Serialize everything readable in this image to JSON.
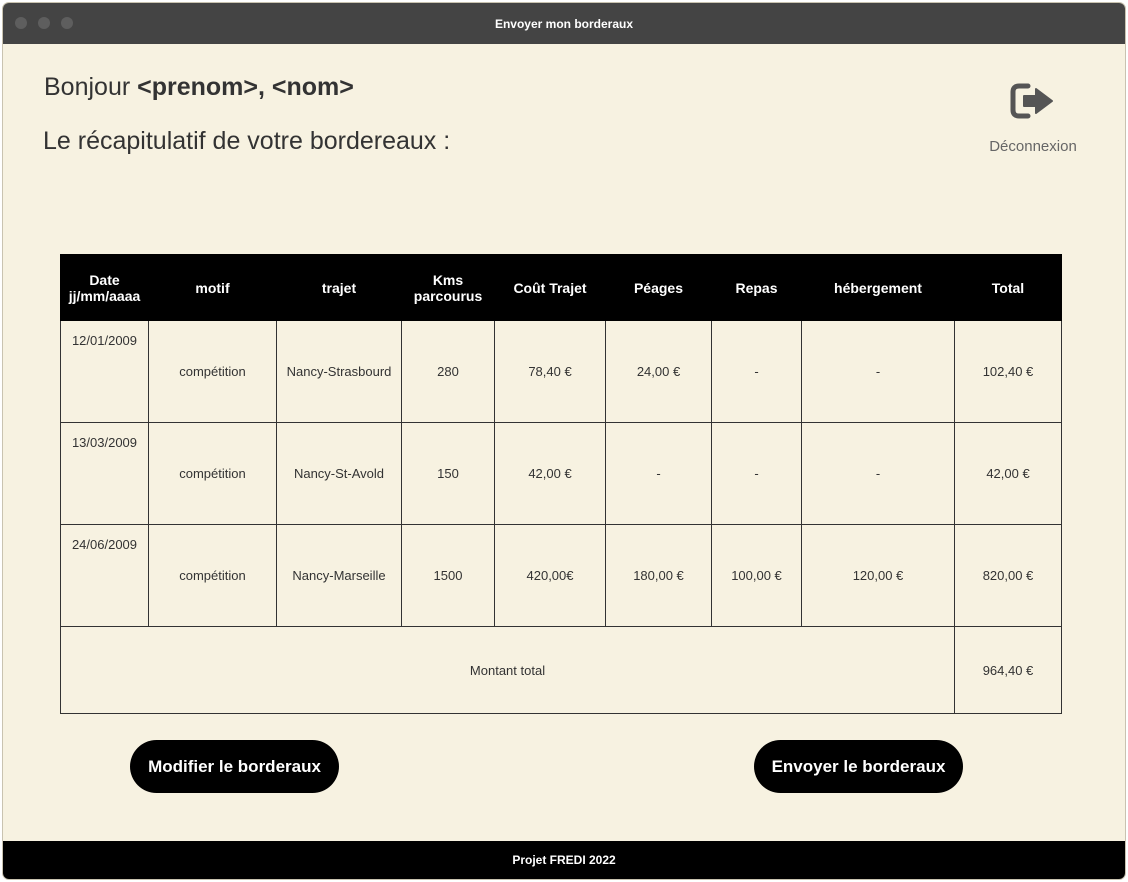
{
  "window": {
    "title": "Envoyer mon borderaux"
  },
  "header": {
    "greeting_prefix": "Bonjour",
    "greeting_name": "<prenom>, <nom>",
    "subtitle": "Le récapitulatif de votre bordereaux :",
    "logout": {
      "icon": "sign-out-icon",
      "label": "Déconnexion"
    }
  },
  "table": {
    "columns": {
      "date_l1": "Date",
      "date_l2": "jj/mm/aaaa",
      "motif": "motif",
      "trajet": "trajet",
      "kms_l1": "Kms",
      "kms_l2": "parcourus",
      "cout": "Coût Trajet",
      "peages": "Péages",
      "repas": "Repas",
      "hebergement": "hébergement",
      "total": "Total"
    },
    "rows": [
      {
        "date": "12/01/2009",
        "motif": "compétition",
        "trajet": "Nancy-Strasbourd",
        "kms": "280",
        "cout": "78,40 €",
        "peages": "24,00 €",
        "repas": "-",
        "hebergement": "-",
        "total": "102,40 €"
      },
      {
        "date": "13/03/2009",
        "motif": "compétition",
        "trajet": "Nancy-St-Avold",
        "kms": "150",
        "cout": "42,00 €",
        "peages": "-",
        "repas": "-",
        "hebergement": "-",
        "total": "42,00 €"
      },
      {
        "date": "24/06/2009",
        "motif": "compétition",
        "trajet": "Nancy-Marseille",
        "kms": "1500",
        "cout": "420,00€",
        "peages": "180,00 €",
        "repas": "100,00 €",
        "hebergement": "120,00 €",
        "total": "820,00 €"
      }
    ],
    "total_label": "Montant total",
    "total_value": "964,40 €"
  },
  "buttons": {
    "modify": "Modifier le borderaux",
    "send": "Envoyer le borderaux"
  },
  "footer": {
    "text": "Projet FREDI 2022"
  },
  "colors": {
    "background": "#f7f2e1",
    "titlebar": "#444444",
    "primary": "#000000"
  }
}
